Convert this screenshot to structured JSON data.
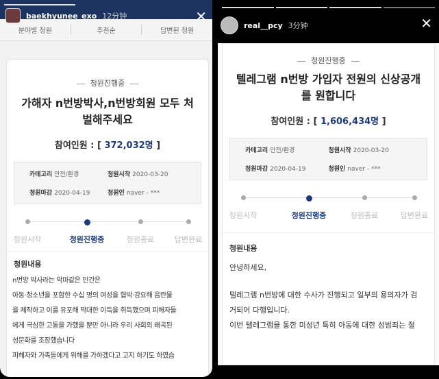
{
  "left": {
    "story": {
      "username": "baekhyunee_exo",
      "time": "12分钟"
    },
    "nav": [
      "분야별 청원",
      "추천순",
      "답변된 청원"
    ],
    "status": "청원진행중",
    "title": "가해자 n번방박사,n번방회원 모두 처벌해주세요",
    "count_label": "참여인원 : [",
    "count": "372,032명",
    "count_end": "]",
    "info": {
      "category_label": "카테고리",
      "category": "안전/환경",
      "start_label": "청원시작",
      "start": "2020-03-20",
      "end_label": "청원마감",
      "end": "2020-04-19",
      "author_label": "청원인",
      "author": "naver - ***"
    },
    "steps": [
      "청원시작",
      "청원진행중",
      "청원종료",
      "답변완료"
    ],
    "section": "청원내용",
    "body": [
      "n번방 박사라는 악마같은 인간은",
      "아동·청소년을 포함한 수십 명의 여성을 협박·강요해 음란물",
      "을 제작하고 이를 유포해 막대한 이득을 취득했으며 피해자들",
      "에게 극심한 고통을 가했을 뿐만 아니라 우리 사회의 왜곡된",
      "성문화를 조장했습니다",
      "피해자와 가족들에게 위해를 가하겠다고 고지 하기도 하였습"
    ]
  },
  "right": {
    "story": {
      "username": "real__pcy",
      "time": "3分钟"
    },
    "status": "청원진행중",
    "title": "텔레그램 n번방 가입자 전원의 신상공개를 원합니다",
    "count_label": "참여인원 : [",
    "count": "1,606,434명",
    "count_end": "]",
    "info": {
      "category_label": "카테고리",
      "category": "안전/환경",
      "start_label": "청원시작",
      "start": "2020-03-20",
      "end_label": "청원마감",
      "end": "2020-04-19",
      "author_label": "청원인",
      "author": "naver - ***"
    },
    "steps": [
      "청원시작",
      "청원진행중",
      "청원종료",
      "답변완료"
    ],
    "section": "청원내용",
    "body": [
      "안녕하세요,",
      "",
      "텔레그램 n번방에 대한 수사가 진행되고 일부의 용의자가 검",
      "거되어 다행입니다.",
      "이번 텔레그램을 통한 미성년 특히 아동에 대한 성범죄는 절"
    ]
  }
}
